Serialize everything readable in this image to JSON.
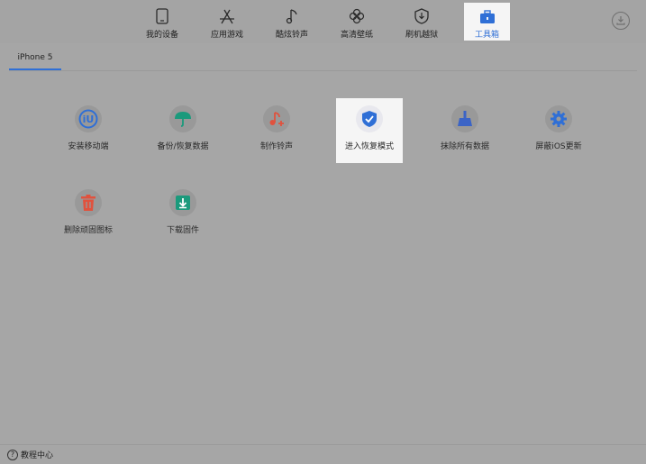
{
  "window": {
    "controls": {
      "close_color": "#ee5a52",
      "min_color": "#e8b52b",
      "max_color": "#39b94a"
    }
  },
  "toolbar": {
    "tabs": [
      {
        "label": "我的设备",
        "icon": "phone-icon"
      },
      {
        "label": "应用游戏",
        "icon": "app-store-icon"
      },
      {
        "label": "酷炫铃声",
        "icon": "music-note-icon"
      },
      {
        "label": "高清壁纸",
        "icon": "clover-icon"
      },
      {
        "label": "刷机越狱",
        "icon": "shield-download-icon"
      },
      {
        "label": "工具箱",
        "icon": "toolbox-icon"
      }
    ],
    "active_index": 5,
    "accent_color": "#2f6fd6",
    "download_icon": "download-icon"
  },
  "device": {
    "tab_label": "iPhone 5"
  },
  "tools": [
    {
      "label": "安装移动端",
      "icon": "iu-app-icon",
      "color": "#2f6fd6"
    },
    {
      "label": "备份/恢复数据",
      "icon": "umbrella-icon",
      "color": "#1b9a7c"
    },
    {
      "label": "制作铃声",
      "icon": "music-plus-icon",
      "color": "#e0523e"
    },
    {
      "label": "进入恢复模式",
      "icon": "shield-check-icon",
      "color": "#2f6fd6"
    },
    {
      "label": "抹除所有数据",
      "icon": "broom-icon",
      "color": "#3b64c6"
    },
    {
      "label": "屏蔽iOS更新",
      "icon": "gear-icon",
      "color": "#2f6fd6"
    },
    {
      "label": "删除顽固图标",
      "icon": "trash-icon",
      "color": "#e0523e"
    },
    {
      "label": "下载固件",
      "icon": "download-box-icon",
      "color": "#1b9a7c"
    }
  ],
  "footer": {
    "help_label": "教程中心",
    "help_icon": "question-icon"
  }
}
